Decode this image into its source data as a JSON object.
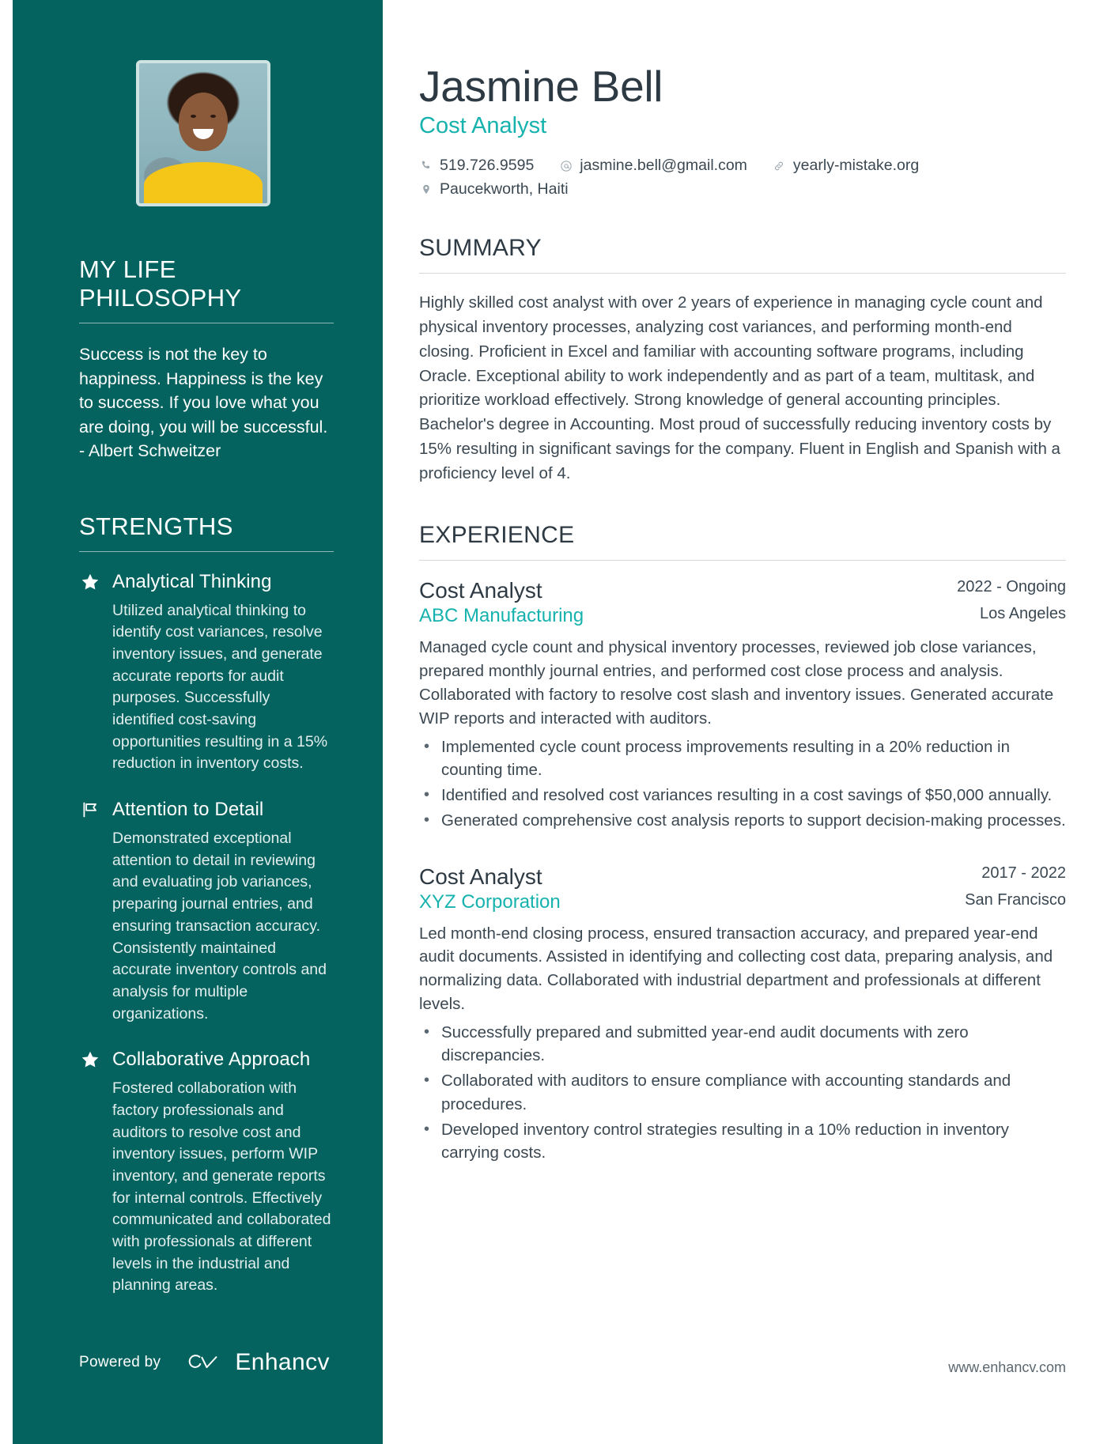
{
  "colors": {
    "sidebar_bg": "#04635f",
    "accent_teal": "#16b2ae",
    "heading": "#2e3a43",
    "body_text": "#3b4852"
  },
  "header": {
    "name": "Jasmine Bell",
    "role": "Cost Analyst",
    "contacts": [
      {
        "icon": "phone-icon",
        "value": "519.726.9595"
      },
      {
        "icon": "email-icon",
        "value": "jasmine.bell@gmail.com"
      },
      {
        "icon": "link-icon",
        "value": "yearly-mistake.org"
      }
    ],
    "location": {
      "icon": "location-pin-icon",
      "value": "Paucekworth, Haiti"
    }
  },
  "sidebar": {
    "photo_alt": "profile-photo",
    "philosophy": {
      "heading": "MY LIFE PHILOSOPHY",
      "text": "Success is not the key to happiness. Happiness is the key to success. If you love what you are doing, you will be successful. - Albert Schweitzer"
    },
    "strengths": {
      "heading": "STRENGTHS",
      "items": [
        {
          "icon": "star-icon",
          "title": "Analytical Thinking",
          "body": "Utilized analytical thinking to identify cost variances, resolve inventory issues, and generate accurate reports for audit purposes. Successfully identified cost-saving opportunities resulting in a 15% reduction in inventory costs."
        },
        {
          "icon": "flag-icon",
          "title": "Attention to Detail",
          "body": "Demonstrated exceptional attention to detail in reviewing and evaluating job variances, preparing journal entries, and ensuring transaction accuracy. Consistently maintained accurate inventory controls and analysis for multiple organizations."
        },
        {
          "icon": "star-icon",
          "title": "Collaborative Approach",
          "body": "Fostered collaboration with factory professionals and auditors to resolve cost and inventory issues, perform WIP inventory, and generate reports for internal controls. Effectively communicated and collaborated with professionals at different levels in the industrial and planning areas."
        }
      ]
    },
    "footer": {
      "powered_by": "Powered by",
      "brand": "Enhancv"
    }
  },
  "main": {
    "summary": {
      "heading": "SUMMARY",
      "text": "Highly skilled cost analyst with over 2 years of experience in managing cycle count and physical inventory processes, analyzing cost variances, and performing month-end closing. Proficient in Excel and familiar with accounting software programs, including Oracle. Exceptional ability to work independently and as part of a team, multitask, and prioritize workload effectively. Strong knowledge of general accounting principles. Bachelor's degree in Accounting. Most proud of successfully reducing inventory costs by 15% resulting in significant savings for the company. Fluent in English and Spanish with a proficiency level of 4."
    },
    "experience": {
      "heading": "EXPERIENCE",
      "jobs": [
        {
          "title": "Cost Analyst",
          "dates": "2022 - Ongoing",
          "company": "ABC Manufacturing",
          "location": "Los Angeles",
          "description": "Managed cycle count and physical inventory processes, reviewed job close variances, prepared monthly journal entries, and performed cost close process and analysis. Collaborated with factory to resolve cost slash and inventory issues. Generated accurate WIP reports and interacted with auditors.",
          "bullets": [
            "Implemented cycle count process improvements resulting in a 20% reduction in counting time.",
            "Identified and resolved cost variances resulting in a cost savings of $50,000 annually.",
            "Generated comprehensive cost analysis reports to support decision-making processes."
          ]
        },
        {
          "title": "Cost Analyst",
          "dates": "2017 - 2022",
          "company": "XYZ Corporation",
          "location": "San Francisco",
          "description": "Led month-end closing process, ensured transaction accuracy, and prepared year-end audit documents. Assisted in identifying and collecting cost data, preparing analysis, and normalizing data. Collaborated with industrial department and professionals at different levels.",
          "bullets": [
            "Successfully prepared and submitted year-end audit documents with zero discrepancies.",
            "Collaborated with auditors to ensure compliance with accounting standards and procedures.",
            "Developed inventory control strategies resulting in a 10% reduction in inventory carrying costs."
          ]
        }
      ]
    },
    "footer_url": "www.enhancv.com"
  }
}
